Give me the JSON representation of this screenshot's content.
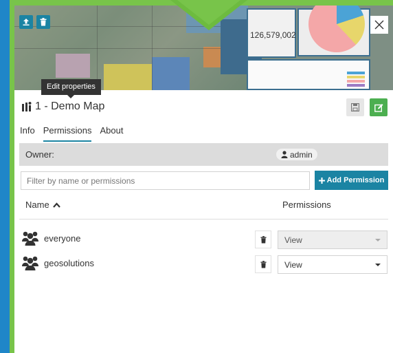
{
  "thumbnail": {
    "widget_number": "126,579,002"
  },
  "tooltip": {
    "text": "Edit properties"
  },
  "header": {
    "title": "1 - Demo Map"
  },
  "tabs": [
    {
      "label": "Info",
      "active": false
    },
    {
      "label": "Permissions",
      "active": true
    },
    {
      "label": "About",
      "active": false
    }
  ],
  "owner": {
    "label": "Owner:",
    "name": "admin"
  },
  "filter": {
    "placeholder": "Filter by name or permissions"
  },
  "add_permission": {
    "label": "Add Permission"
  },
  "table": {
    "name_header": "Name",
    "permissions_header": "Permissions"
  },
  "rows": [
    {
      "name": "everyone",
      "permission": "View",
      "disabled": true
    },
    {
      "name": "geosolutions",
      "permission": "View",
      "disabled": false
    }
  ],
  "colors": {
    "accent": "#1b84a3",
    "frame_green": "#78c44a",
    "edit_green": "#4caf50",
    "background_blue": "#1f86c8"
  },
  "icons": {
    "upload": "upload-icon",
    "delete": "trash-icon",
    "close": "close-icon",
    "map": "map-icon",
    "save": "save-icon",
    "edit": "edit-icon",
    "user": "user-icon",
    "group": "group-icon",
    "sort": "sort-up-icon",
    "plus": "plus-icon"
  }
}
